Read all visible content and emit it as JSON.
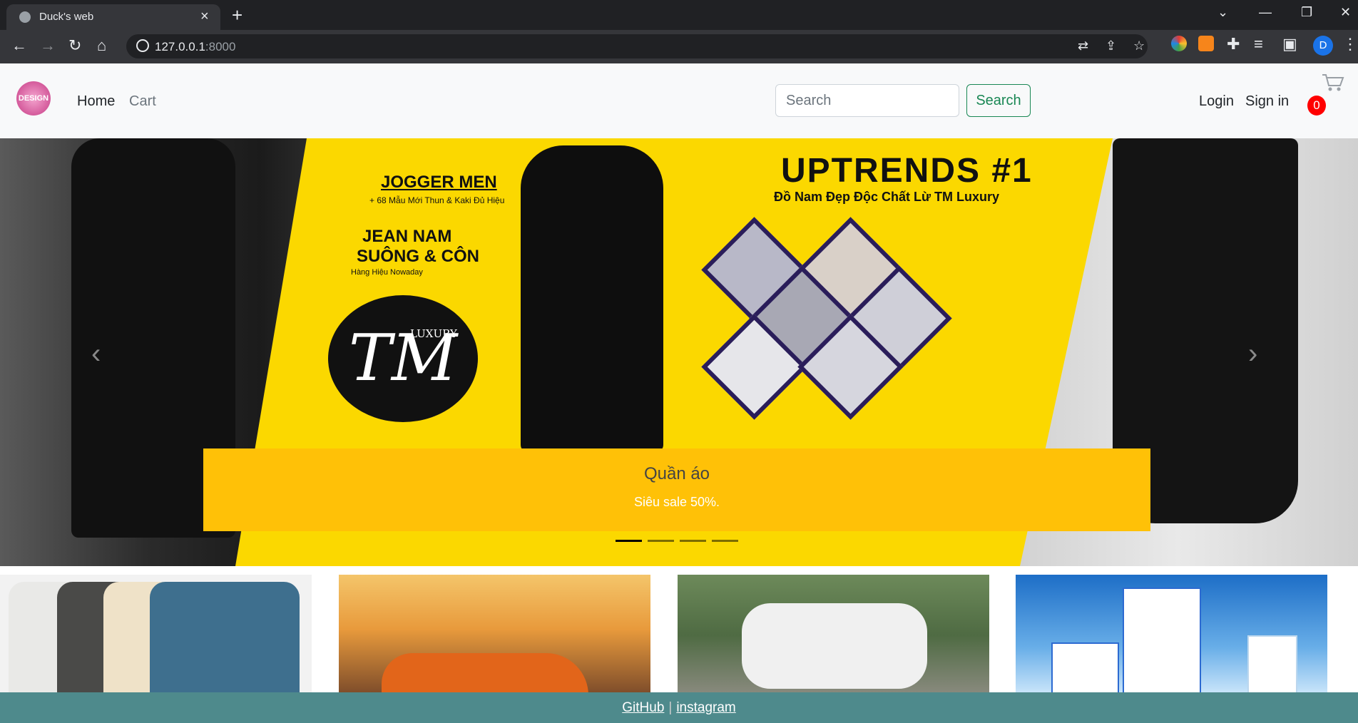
{
  "browser": {
    "tab_title": "Duck's web",
    "url_host": "127.0.0.1",
    "url_port": ":8000",
    "profile_initial": "D"
  },
  "navbar": {
    "links": [
      "Home",
      "Cart"
    ],
    "search_placeholder": "Search",
    "search_button": "Search",
    "login": "Login",
    "signin": "Sign in",
    "cart_count": "0",
    "logo_text": "DESIGN"
  },
  "banner": {
    "headline": "UPTRENDS #1",
    "subheadline": "Đồ Nam Đẹp Độc Chất Lừ TM Luxury",
    "jogger_title": "JOGGER MEN",
    "jogger_sub": "+ 68 Mẫu Mới Thun & Kaki Đủ Hiệu",
    "jean_title_1": "JEAN NAM",
    "jean_title_2": "SUÔNG & CÔN",
    "jean_sub": "Hàng Hiệu Nowaday",
    "logo_tm": "TM",
    "logo_luxury": "LUXURY"
  },
  "carousel": {
    "caption_title": "Quần áo",
    "caption_text": "Siêu sale 50%.",
    "indicator_count": 4,
    "active_index": 0
  },
  "footer": {
    "github": "GitHub",
    "separator": "|",
    "instagram": "instagram"
  }
}
